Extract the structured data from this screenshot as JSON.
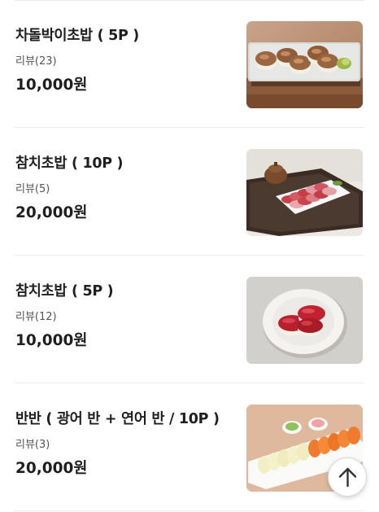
{
  "menu": {
    "items": [
      {
        "name": "차돌박이초밥 ( 5P )",
        "review": "리뷰(23)",
        "price": "10,000원"
      },
      {
        "name": "참치초밥 ( 10P )",
        "review": "리뷰(5)",
        "price": "20,000원"
      },
      {
        "name": "참치초밥 ( 5P )",
        "review": "리뷰(12)",
        "price": "10,000원"
      },
      {
        "name": "반반 ( 광어 반 + 연어 반 / 10P )",
        "review": "리뷰(3)",
        "price": "20,000원"
      }
    ]
  },
  "scroll_top": {
    "icon": "arrow-up-icon"
  },
  "colors": {
    "text": "#1f1f1f",
    "subtext": "#555555",
    "divider": "#ececec"
  }
}
